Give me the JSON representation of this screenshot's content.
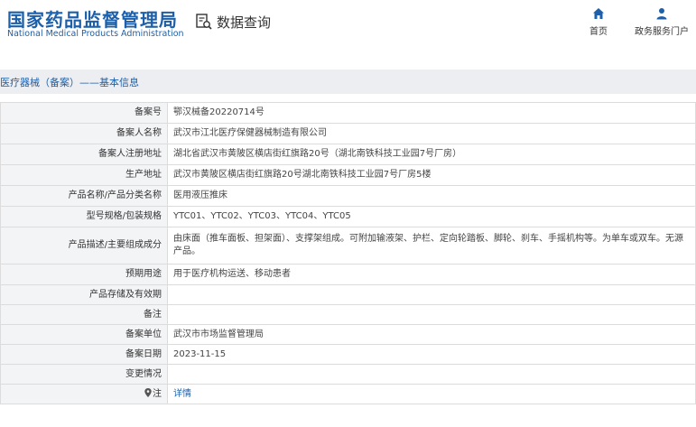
{
  "header": {
    "logo_cn": "国家药品监督管理局",
    "logo_en": "National Medical Products Administration",
    "query_label": "数据查询",
    "nav_home": "首页",
    "nav_service": "政务服务门户"
  },
  "breadcrumb": "医疗器械（备案）——基本信息",
  "colors": {
    "brand": "#1d5fa8",
    "label_bg": "#f3f4f6",
    "subnav_bg": "#eceef1"
  },
  "rows": [
    {
      "label": "备案号",
      "value": "鄂汉械备20220714号"
    },
    {
      "label": "备案人名称",
      "value": "武汉市江北医疗保健器械制造有限公司"
    },
    {
      "label": "备案人注册地址",
      "value": "湖北省武汉市黄陂区横店街红旗路20号（湖北南铁科技工业园7号厂房）"
    },
    {
      "label": "生产地址",
      "value": "武汉市黄陂区横店街红旗路20号湖北南铁科技工业园7号厂房5楼"
    },
    {
      "label": "产品名称/产品分类名称",
      "value": "医用液压推床"
    },
    {
      "label": "型号规格/包装规格",
      "value": "YTC01、YTC02、YTC03、YTC04、YTC05"
    },
    {
      "label": "产品描述/主要组成成分",
      "value": "由床面（推车面板、担架面）、支撑架组成。可附加输液架、护栏、定向轮踏板、脚轮、刹车、手摇机构等。为单车或双车。无源产品。"
    },
    {
      "label": "预期用途",
      "value": "用于医疗机构运送、移动患者"
    },
    {
      "label": "产品存储及有效期",
      "value": ""
    },
    {
      "label": "备注",
      "value": ""
    },
    {
      "label": "备案单位",
      "value": "武汉市市场监督管理局"
    },
    {
      "label": "备案日期",
      "value": "2023-11-15"
    },
    {
      "label": "变更情况",
      "value": ""
    },
    {
      "label": "注",
      "value": "详情"
    }
  ]
}
